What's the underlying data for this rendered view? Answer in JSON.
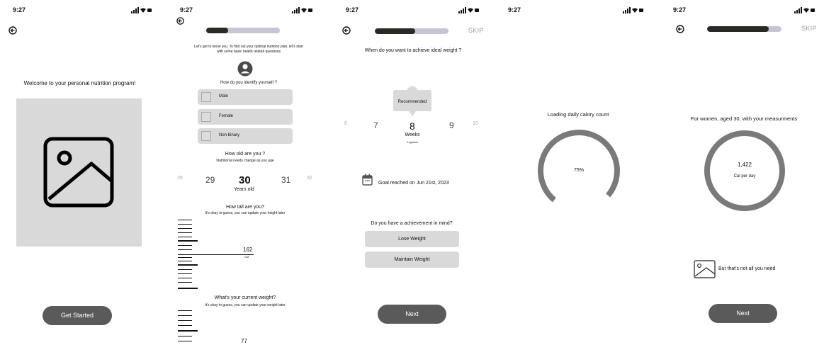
{
  "status_bar": {
    "time": "9:27"
  },
  "screen1": {
    "title": "Welcome to your personal nutrition program!",
    "cta": "Get Started",
    "illustration_icon": "image-icon"
  },
  "screen2": {
    "progress": 0.3,
    "intro": "Let's get to know you. To find out your optimal nutrition plan,  let's start",
    "intro2": "with some basic health related questions",
    "avatar_icon": "user-avatar-icon",
    "identify_q": "How do you identify yourself ?",
    "options": [
      "Male",
      "Female",
      "Non binary"
    ],
    "age_q": "How old are you ?",
    "age_sub": "Nutritional needs change as you age",
    "ages": [
      "28",
      "29",
      "30",
      "31",
      "32"
    ],
    "age_unit": "Years old",
    "height_q": "How tall are you?",
    "height_sub": "It's okay to guess, you can update your height later",
    "height_value": "162",
    "height_unit": "CM",
    "weight_q": "What's your current weight?",
    "weight_sub": "It's okay to guess, you can update your weight later",
    "weight_value": "77"
  },
  "screen3": {
    "progress": 0.55,
    "skip": "SKIP",
    "question": "When do you want to achieve ideal weight ?",
    "recommended": "Recommended",
    "weeks": [
      "6",
      "7",
      "8",
      "9",
      "10"
    ],
    "weeks_unit": "Weeks",
    "weeks_sub": "0 kg/week",
    "goal_text": "Goal reached on Jun 21st, 2023",
    "calendar_icon": "calendar-icon",
    "achievement_q": "Do you have a achievement in mind?",
    "achievements": [
      "Lose Weight",
      "Maintain Weight"
    ],
    "cta": "Next"
  },
  "screen4": {
    "title": "Loading daily calory count",
    "percent_label": "75%",
    "progress": 0.75
  },
  "screen5": {
    "progress": 0.83,
    "skip": "SKIP",
    "summary": "For women, aged 30, with your measurments",
    "calories": "1,422",
    "calories_unit": "Cal per day",
    "note": "But that's not all you need",
    "note_icon": "image-icon",
    "cta": "Next"
  }
}
